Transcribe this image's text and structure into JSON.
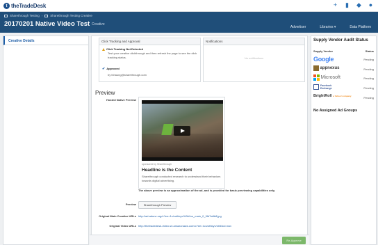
{
  "brand": {
    "logo_text": "theTradeDesk"
  },
  "topbar": {
    "icons": [
      "plus-icon",
      "bar-chart-icon",
      "handshake-icon",
      "user-icon"
    ]
  },
  "breadcrumb": {
    "item1": "Sharethrough Testing",
    "item2": "Sharethrough Testing Creative"
  },
  "header": {
    "title": "20170201 Native Video Test",
    "subtitle": "Creative"
  },
  "nav": {
    "advertiser": "Advertiser",
    "libraries": "Libraries ▾",
    "data_platform": "Data Platform"
  },
  "sidebar": {
    "active_item": "Creative Details"
  },
  "click_tracking": {
    "header": "Click Tracking and Approval",
    "status_title": "Click Tracking Not Detected",
    "status_text": "Test your creative clickthrough and then refresh the page to see the click tracking status.",
    "approved_title": "Approved",
    "approved_by": "by fchaung@sharethrough.com"
  },
  "notifications": {
    "header": "Notifications",
    "empty": "No notifications"
  },
  "preview": {
    "section_title": "Preview",
    "hosted_label": "Hosted Native Preview",
    "sponsored": "sponsored by Sharethrough",
    "headline": "Headline is the Content",
    "description": "Sharethrough conducted research to understand their behaviors towards digital advertising.",
    "note": "The above preview is an approximation of the ad, and is provided for basic previewing capabilities only.",
    "preview_label": "Preview",
    "preview_button": "Sharethrough Preview",
    "orig_creative_label": "Original Main Creative URLs",
    "orig_creative_url": "http://ad.adsrvr.org/c?ee=1c/zothkyv%2bf/oo_main_0_9fd7a8b8.jpg",
    "orig_video_label": "Original Video URLs",
    "orig_video_url": "http://thetradedesk-video.s3.amazonaws.com/c?ee=1c/zothkyv/zb53cd.mov"
  },
  "footer": {
    "approve_button": "Re-Approve"
  },
  "audit": {
    "title": "Supply Vendor Audit Status",
    "col_vendor": "Supply Vendor",
    "col_status": "Status",
    "vendors": [
      {
        "name": "Google",
        "status": "Pending"
      },
      {
        "name": "appnexus",
        "status": "Pending"
      },
      {
        "name": "Microsoft",
        "status": "Pending"
      },
      {
        "name": "Facebook",
        "sub": "Exchange",
        "status": "Pending"
      },
      {
        "name": "BrightRoll",
        "sub": "a Yahoo! company",
        "status": "Pending"
      }
    ],
    "no_groups": "No Assigned Ad Groups"
  },
  "colors": {
    "header_bg": "#1f4e79",
    "accent": "#1f5fa8",
    "approve": "#7cb86a"
  }
}
